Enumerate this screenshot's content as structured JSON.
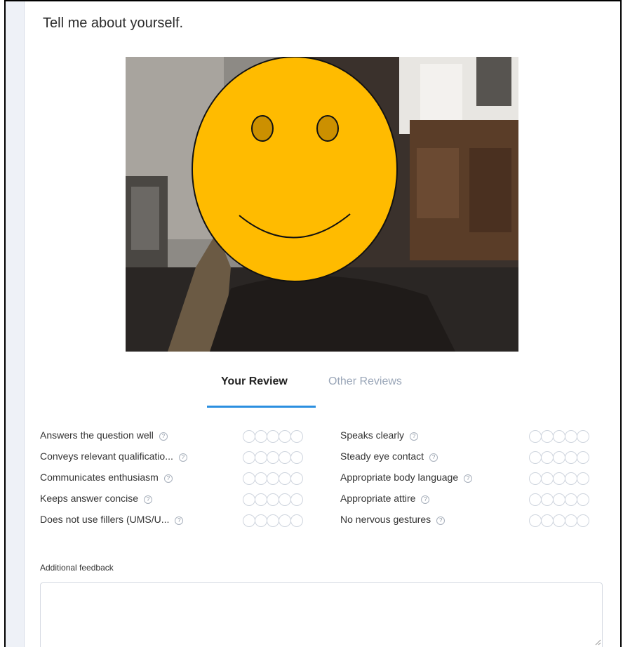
{
  "question": "Tell me about yourself.",
  "tabs": {
    "your_review": "Your Review",
    "other_reviews": "Other Reviews"
  },
  "criteria_left": [
    {
      "label": "Answers the question well",
      "help": "?",
      "rating": 0
    },
    {
      "label": "Conveys relevant qualificatio...",
      "help": "?",
      "rating": 0
    },
    {
      "label": "Communicates enthusiasm",
      "help": "?",
      "rating": 0
    },
    {
      "label": "Keeps answer concise",
      "help": "?",
      "rating": 0
    },
    {
      "label": "Does not use fillers (UMS/U...",
      "help": "?",
      "rating": 0
    }
  ],
  "criteria_right": [
    {
      "label": "Speaks clearly",
      "help": "?",
      "rating": 0
    },
    {
      "label": "Steady eye contact",
      "help": "?",
      "rating": 0
    },
    {
      "label": "Appropriate body language",
      "help": "?",
      "rating": 0
    },
    {
      "label": "Appropriate attire",
      "help": "?",
      "rating": 0
    },
    {
      "label": "No nervous gestures",
      "help": "?",
      "rating": 0
    }
  ],
  "rating_scale_max": 5,
  "feedback": {
    "label": "Additional feedback",
    "value": "",
    "placeholder": ""
  },
  "colors": {
    "accent": "#2b8fe0",
    "smiley": "#ffbb00",
    "inactive_tab": "#9aa6b8"
  }
}
